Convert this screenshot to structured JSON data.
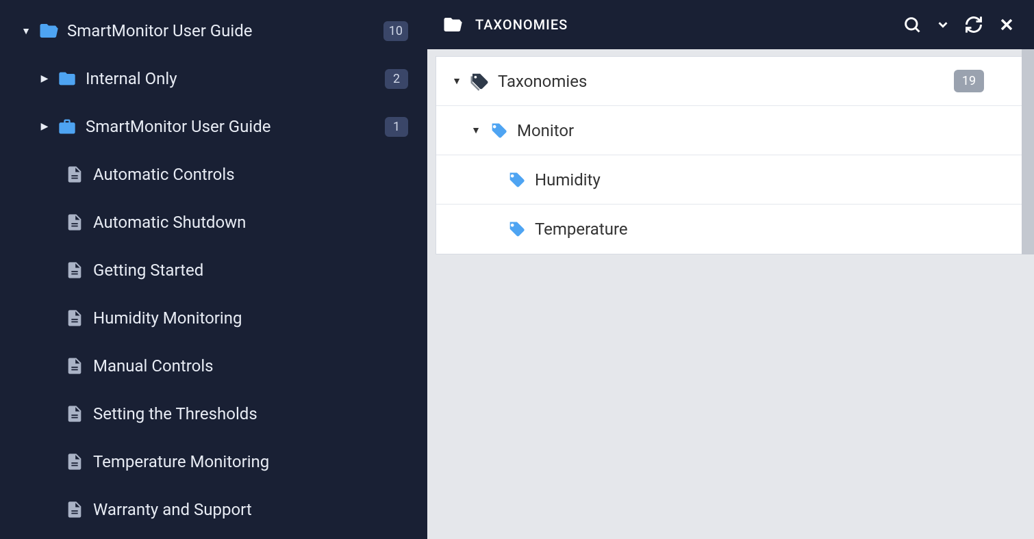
{
  "sidebar": {
    "root": {
      "label": "SmartMonitor User Guide",
      "count": "10"
    },
    "children": [
      {
        "label": "Internal Only",
        "count": "2",
        "type": "folder"
      },
      {
        "label": "SmartMonitor User Guide",
        "count": "1",
        "type": "briefcase"
      },
      {
        "label": "Automatic Controls",
        "type": "doc"
      },
      {
        "label": "Automatic Shutdown",
        "type": "doc"
      },
      {
        "label": "Getting Started",
        "type": "doc"
      },
      {
        "label": "Humidity Monitoring",
        "type": "doc"
      },
      {
        "label": "Manual Controls",
        "type": "doc"
      },
      {
        "label": "Setting the Thresholds",
        "type": "doc"
      },
      {
        "label": "Temperature Monitoring",
        "type": "doc"
      },
      {
        "label": "Warranty and Support",
        "type": "doc"
      }
    ]
  },
  "panel": {
    "title": "TAXONOMIES",
    "root": {
      "label": "Taxonomies",
      "count": "19"
    },
    "group": {
      "label": "Monitor"
    },
    "items": [
      {
        "label": "Humidity"
      },
      {
        "label": "Temperature"
      }
    ]
  }
}
